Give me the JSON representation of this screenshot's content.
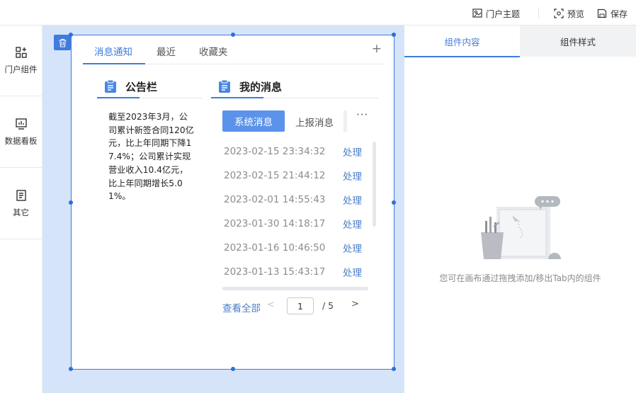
{
  "topbar": {
    "theme_label": "门户主题",
    "preview_label": "预览",
    "save_label": "保存"
  },
  "sidebar": {
    "items": [
      {
        "label": "门户组件",
        "icon": "widgets-icon"
      },
      {
        "label": "数据看板",
        "icon": "dashboard-icon"
      },
      {
        "label": "其它",
        "icon": "document-icon"
      }
    ]
  },
  "widget": {
    "tabs": [
      {
        "label": "消息通知",
        "active": true
      },
      {
        "label": "最近",
        "active": false
      },
      {
        "label": "收藏夹",
        "active": false
      }
    ],
    "add_tab_label": "+",
    "notice": {
      "title": "公告栏",
      "text": "截至2023年3月，公司累计新签合同120亿元，比上年同期下降17.4%；公司累计实现营业收入10.4亿元，比上年同期增长5.01%。"
    },
    "messages": {
      "title": "我的消息",
      "subtabs": [
        {
          "label": "系统消息",
          "active": true
        },
        {
          "label": "上报消息",
          "active": false
        }
      ],
      "more_label": "···",
      "rows": [
        {
          "time": "2023-02-15 23:34:32",
          "action": "处理"
        },
        {
          "time": "2023-02-15 21:44:12",
          "action": "处理"
        },
        {
          "time": "2023-02-01 14:55:43",
          "action": "处理"
        },
        {
          "time": "2023-01-30 14:18:17",
          "action": "处理"
        },
        {
          "time": "2023-01-16 10:46:50",
          "action": "处理"
        },
        {
          "time": "2023-01-13 15:43:17",
          "action": "处理"
        }
      ],
      "view_all_label": "查看全部",
      "pagination": {
        "prev": "<",
        "current": "1",
        "total_text": "/ 5",
        "next": ">"
      }
    }
  },
  "right_panel": {
    "tabs": [
      {
        "label": "组件内容",
        "active": true
      },
      {
        "label": "组件样式",
        "active": false
      }
    ],
    "empty_hint": "您可在画布通过拖拽添加/移出Tab内的组件"
  },
  "colors": {
    "accent": "#3f7cdc",
    "canvas_bg": "#d6e4fa",
    "link": "#4a7fc9"
  }
}
